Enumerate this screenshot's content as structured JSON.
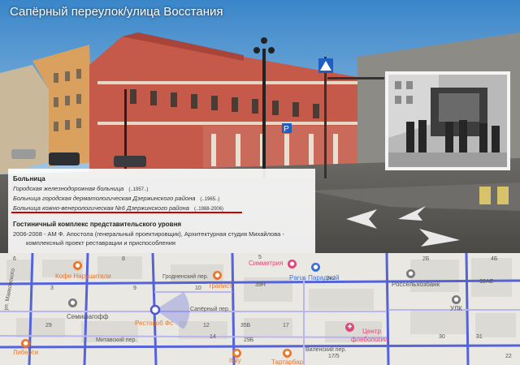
{
  "panorama": {
    "title": "Сапёрный переулок/улица Восстания"
  },
  "info_panel": {
    "section1_heading": "Больница",
    "items": [
      {
        "name": "Городская железнодорожная больница",
        "years": "(..1957..)"
      },
      {
        "name": "Больница городская дерматологическая Дзержинского района",
        "years": "(..1965..)"
      },
      {
        "name": "Больница кожно-венерологическая №6 Дзержинского района",
        "years": "(..1988-2006)"
      }
    ],
    "section2_heading": "Гостиничный комплекс представительского уровня",
    "section2_line1": "2006-2008 - АМ Ф. Апостола (генеральный проектировщик), Архитектурная студия Михайлова -",
    "section2_line2": "комплексный проект реставрации и приспособления",
    "highlight_color": "#d10000"
  },
  "map": {
    "poi": [
      {
        "label": "Кофе Нарушители",
        "color": "#e8772e"
      },
      {
        "label": "Семишагофф",
        "color": "#555555"
      },
      {
        "label": "Рестопоб Фс",
        "color": "#e8772e"
      },
      {
        "label": "Либерти",
        "color": "#e8772e"
      },
      {
        "label": "Трапист",
        "color": "#e8772e"
      },
      {
        "label": "Симметрия",
        "color": "#e0457a"
      },
      {
        "label": "Parus Парадный",
        "color": "#3c6fd6"
      },
      {
        "label": "Россельхозбанк",
        "color": "#555555"
      },
      {
        "label": "Центр",
        "color": "#e0457a"
      },
      {
        "label": "флебологии",
        "color": "#e0457a"
      },
      {
        "label": "Italy",
        "color": "#e8772e"
      },
      {
        "label": "Тартарбар",
        "color": "#e8772e"
      },
      {
        "label": "УЛК",
        "color": "#555555"
      }
    ],
    "streets": [
      "Гродненский пер.",
      "Сапёрный пер.",
      "Митавский пер.",
      "Виленский пер.",
      "ул. Маяковского"
    ],
    "numbers": [
      "6",
      "8",
      "9",
      "29",
      "10",
      "12",
      "14",
      "5",
      "39Н",
      "3к2",
      "4Б",
      "32АЕ",
      "35Б",
      "29Б",
      "17",
      "30",
      "31",
      "2Б",
      "3",
      "17/5",
      "22"
    ]
  }
}
